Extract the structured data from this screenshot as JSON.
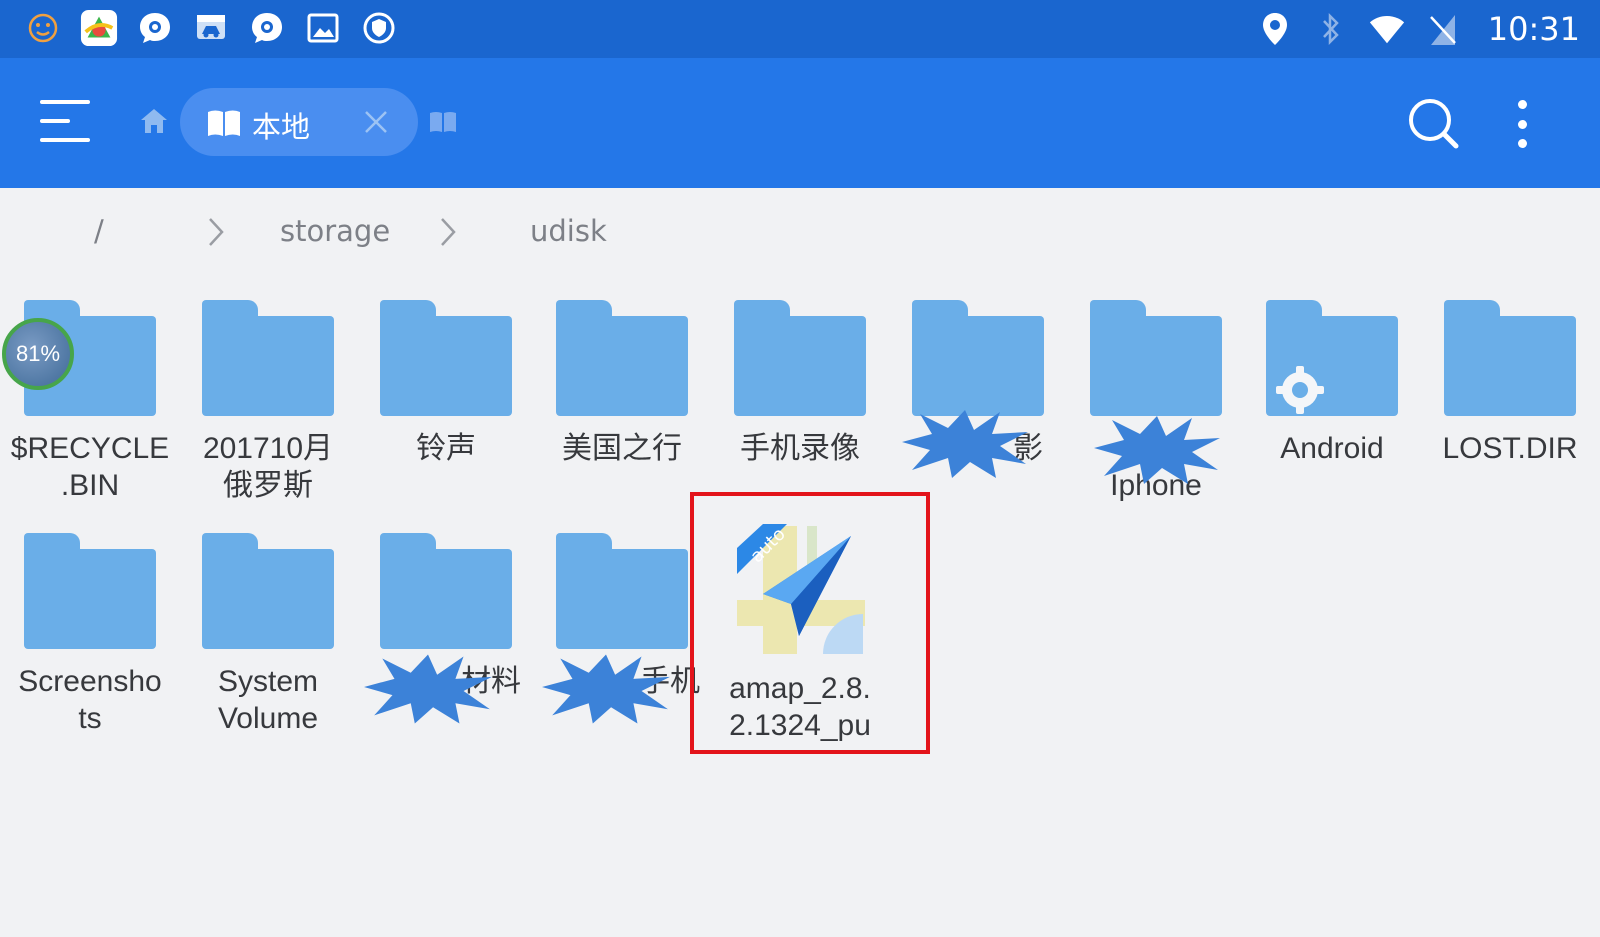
{
  "status_bar": {
    "time": "10:31",
    "left_icons": [
      "emoji-icon",
      "app-launcher-icon",
      "chat-icon",
      "car-monitor-icon",
      "chat-icon-2",
      "gallery-icon",
      "shield-icon"
    ],
    "right_icons": [
      "location-icon",
      "bluetooth-icon",
      "wifi-icon",
      "no-sim-icon"
    ]
  },
  "app_bar": {
    "tab_label": "本地",
    "icons": [
      "menu-icon",
      "home-icon",
      "book-icon",
      "close-icon",
      "search-icon",
      "more-vert-icon"
    ]
  },
  "breadcrumb": {
    "items": [
      "/",
      "storage",
      "udisk"
    ]
  },
  "colors": {
    "status_bar": "#1a66cf",
    "app_bar": "#2477e8",
    "folder": "#6aaee8",
    "background": "#f1f2f4",
    "highlight": "#e3141b"
  },
  "floating_badge": "81%",
  "files": [
    {
      "name": "$RECYCLE\n.BIN",
      "type": "folder"
    },
    {
      "name": "201710月\n俄罗斯",
      "type": "folder"
    },
    {
      "name": "铃声",
      "type": "folder"
    },
    {
      "name": "美国之行",
      "type": "folder"
    },
    {
      "name": "手机录像",
      "type": "folder"
    },
    {
      "name": "影",
      "type": "folder",
      "redacted": true
    },
    {
      "name": "Iphone",
      "type": "folder",
      "redacted": true
    },
    {
      "name": "Android",
      "type": "folder",
      "icon": "gear-icon"
    },
    {
      "name": "LOST.DIR",
      "type": "folder"
    },
    {
      "name": "Screensho\nts",
      "type": "folder"
    },
    {
      "name": "System\nVolume",
      "type": "folder"
    },
    {
      "name": "材料",
      "type": "folder",
      "redacted": true
    },
    {
      "name": "手机",
      "type": "folder",
      "redacted": true
    },
    {
      "name": "amap_2.8.\n2.1324_pu",
      "type": "apk",
      "selected": true,
      "badge": "auto"
    }
  ]
}
